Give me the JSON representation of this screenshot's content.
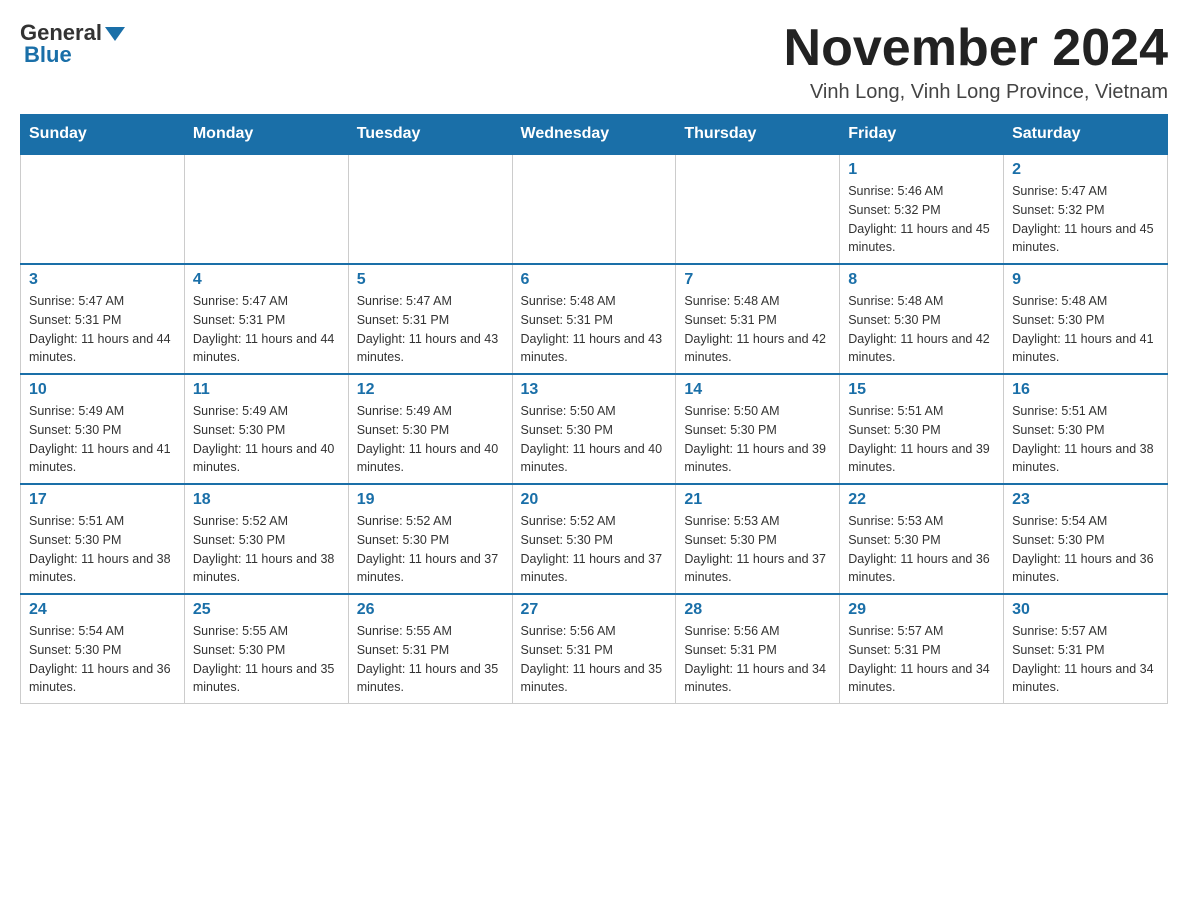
{
  "logo": {
    "general": "General",
    "blue": "Blue"
  },
  "title": "November 2024",
  "subtitle": "Vinh Long, Vinh Long Province, Vietnam",
  "days_of_week": [
    "Sunday",
    "Monday",
    "Tuesday",
    "Wednesday",
    "Thursday",
    "Friday",
    "Saturday"
  ],
  "weeks": [
    [
      {
        "day": "",
        "info": ""
      },
      {
        "day": "",
        "info": ""
      },
      {
        "day": "",
        "info": ""
      },
      {
        "day": "",
        "info": ""
      },
      {
        "day": "",
        "info": ""
      },
      {
        "day": "1",
        "info": "Sunrise: 5:46 AM\nSunset: 5:32 PM\nDaylight: 11 hours and 45 minutes."
      },
      {
        "day": "2",
        "info": "Sunrise: 5:47 AM\nSunset: 5:32 PM\nDaylight: 11 hours and 45 minutes."
      }
    ],
    [
      {
        "day": "3",
        "info": "Sunrise: 5:47 AM\nSunset: 5:31 PM\nDaylight: 11 hours and 44 minutes."
      },
      {
        "day": "4",
        "info": "Sunrise: 5:47 AM\nSunset: 5:31 PM\nDaylight: 11 hours and 44 minutes."
      },
      {
        "day": "5",
        "info": "Sunrise: 5:47 AM\nSunset: 5:31 PM\nDaylight: 11 hours and 43 minutes."
      },
      {
        "day": "6",
        "info": "Sunrise: 5:48 AM\nSunset: 5:31 PM\nDaylight: 11 hours and 43 minutes."
      },
      {
        "day": "7",
        "info": "Sunrise: 5:48 AM\nSunset: 5:31 PM\nDaylight: 11 hours and 42 minutes."
      },
      {
        "day": "8",
        "info": "Sunrise: 5:48 AM\nSunset: 5:30 PM\nDaylight: 11 hours and 42 minutes."
      },
      {
        "day": "9",
        "info": "Sunrise: 5:48 AM\nSunset: 5:30 PM\nDaylight: 11 hours and 41 minutes."
      }
    ],
    [
      {
        "day": "10",
        "info": "Sunrise: 5:49 AM\nSunset: 5:30 PM\nDaylight: 11 hours and 41 minutes."
      },
      {
        "day": "11",
        "info": "Sunrise: 5:49 AM\nSunset: 5:30 PM\nDaylight: 11 hours and 40 minutes."
      },
      {
        "day": "12",
        "info": "Sunrise: 5:49 AM\nSunset: 5:30 PM\nDaylight: 11 hours and 40 minutes."
      },
      {
        "day": "13",
        "info": "Sunrise: 5:50 AM\nSunset: 5:30 PM\nDaylight: 11 hours and 40 minutes."
      },
      {
        "day": "14",
        "info": "Sunrise: 5:50 AM\nSunset: 5:30 PM\nDaylight: 11 hours and 39 minutes."
      },
      {
        "day": "15",
        "info": "Sunrise: 5:51 AM\nSunset: 5:30 PM\nDaylight: 11 hours and 39 minutes."
      },
      {
        "day": "16",
        "info": "Sunrise: 5:51 AM\nSunset: 5:30 PM\nDaylight: 11 hours and 38 minutes."
      }
    ],
    [
      {
        "day": "17",
        "info": "Sunrise: 5:51 AM\nSunset: 5:30 PM\nDaylight: 11 hours and 38 minutes."
      },
      {
        "day": "18",
        "info": "Sunrise: 5:52 AM\nSunset: 5:30 PM\nDaylight: 11 hours and 38 minutes."
      },
      {
        "day": "19",
        "info": "Sunrise: 5:52 AM\nSunset: 5:30 PM\nDaylight: 11 hours and 37 minutes."
      },
      {
        "day": "20",
        "info": "Sunrise: 5:52 AM\nSunset: 5:30 PM\nDaylight: 11 hours and 37 minutes."
      },
      {
        "day": "21",
        "info": "Sunrise: 5:53 AM\nSunset: 5:30 PM\nDaylight: 11 hours and 37 minutes."
      },
      {
        "day": "22",
        "info": "Sunrise: 5:53 AM\nSunset: 5:30 PM\nDaylight: 11 hours and 36 minutes."
      },
      {
        "day": "23",
        "info": "Sunrise: 5:54 AM\nSunset: 5:30 PM\nDaylight: 11 hours and 36 minutes."
      }
    ],
    [
      {
        "day": "24",
        "info": "Sunrise: 5:54 AM\nSunset: 5:30 PM\nDaylight: 11 hours and 36 minutes."
      },
      {
        "day": "25",
        "info": "Sunrise: 5:55 AM\nSunset: 5:30 PM\nDaylight: 11 hours and 35 minutes."
      },
      {
        "day": "26",
        "info": "Sunrise: 5:55 AM\nSunset: 5:31 PM\nDaylight: 11 hours and 35 minutes."
      },
      {
        "day": "27",
        "info": "Sunrise: 5:56 AM\nSunset: 5:31 PM\nDaylight: 11 hours and 35 minutes."
      },
      {
        "day": "28",
        "info": "Sunrise: 5:56 AM\nSunset: 5:31 PM\nDaylight: 11 hours and 34 minutes."
      },
      {
        "day": "29",
        "info": "Sunrise: 5:57 AM\nSunset: 5:31 PM\nDaylight: 11 hours and 34 minutes."
      },
      {
        "day": "30",
        "info": "Sunrise: 5:57 AM\nSunset: 5:31 PM\nDaylight: 11 hours and 34 minutes."
      }
    ]
  ]
}
